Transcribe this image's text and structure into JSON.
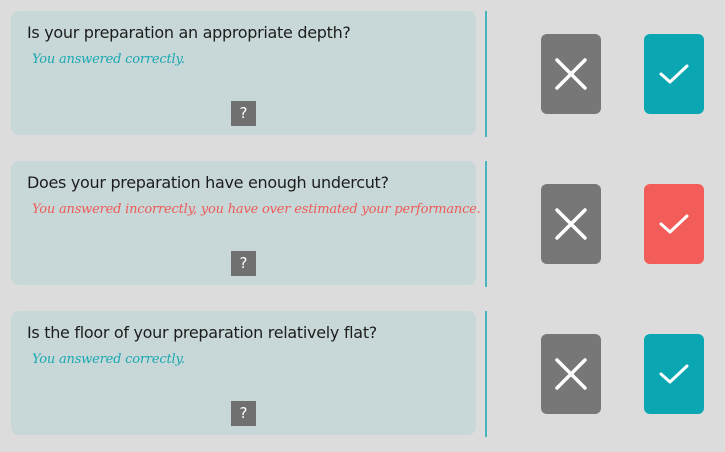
{
  "questions": [
    {
      "text": "Is your preparation an appropriate depth?",
      "feedback": "You answered correctly.",
      "result": "correct",
      "help_label": "?",
      "no_icon": "x-icon",
      "yes_icon": "check-icon",
      "yes_color": "#0aa7b2"
    },
    {
      "text": "Does your preparation have enough undercut?",
      "feedback": "You answered incorrectly, you have over estimated your performance.",
      "result": "incorrect",
      "help_label": "?",
      "no_icon": "x-icon",
      "yes_icon": "check-icon",
      "yes_color": "#f25d59"
    },
    {
      "text": "Is the floor of your preparation relatively flat?",
      "feedback": "You answered correctly.",
      "result": "correct",
      "help_label": "?",
      "no_icon": "x-icon",
      "yes_icon": "check-icon",
      "yes_color": "#0aa7b2"
    }
  ],
  "colors": {
    "background": "#dcdcdc",
    "card": "#c8d8d9",
    "correct_text": "#1aa8b0",
    "incorrect_text": "#ee5a55",
    "no_button": "#777777",
    "divider": "#48b4bd"
  }
}
